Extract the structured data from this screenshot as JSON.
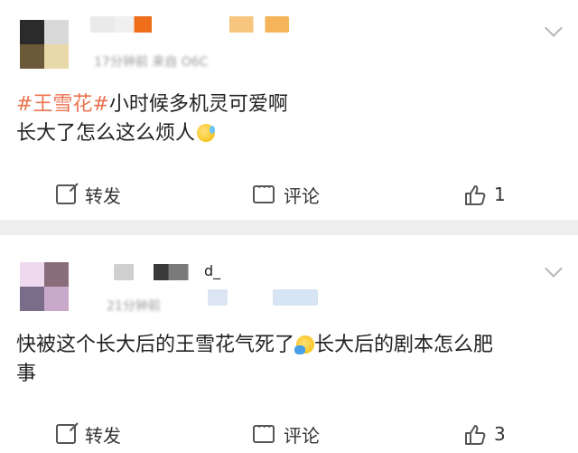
{
  "colors": {
    "accent": "#eb7350",
    "divider": "#eeeeee",
    "muted": "#9a9a9a"
  },
  "posts": [
    {
      "meta": "17分钟前 来自 O6C",
      "content_tag": "#王雪花#",
      "content_text_1": "小时候多机灵可爱啊",
      "content_text_2": "长大了怎么这么烦人",
      "emoji": "sweat-emoji",
      "actions": {
        "share": "转发",
        "comment": "评论",
        "like": "1"
      }
    },
    {
      "meta": "21分钟前",
      "name_partial": "d_",
      "content_text_1": "快被这个长大后的王雪花气死了",
      "content_text_2": "长大后的剧本怎么肥",
      "content_text_3": "事",
      "emoji": "facepalm-emoji",
      "actions": {
        "share": "转发",
        "comment": "评论",
        "like": "3"
      }
    }
  ]
}
